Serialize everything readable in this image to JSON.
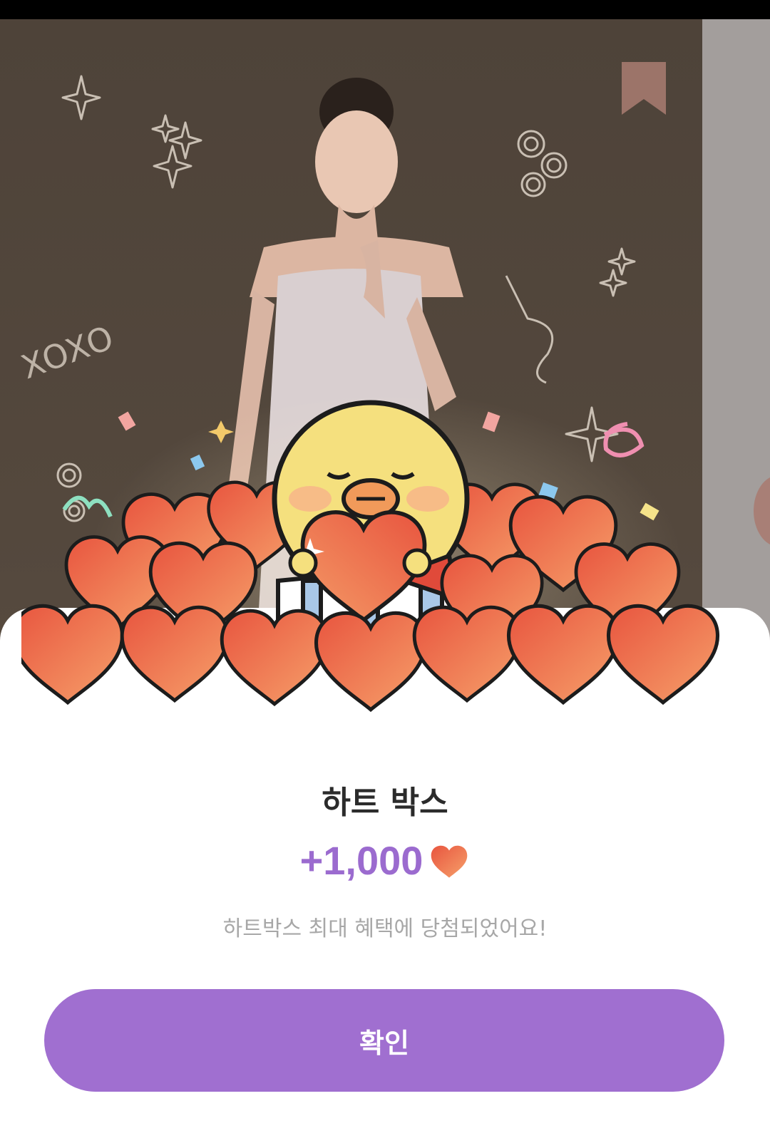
{
  "popup": {
    "title": "하트 박스",
    "reward_amount": "+1,000",
    "reward_icon": "heart-icon",
    "message": "하트박스 최대 혜택에 당첨되었어요!",
    "confirm_label": "확인"
  },
  "background": {
    "doodle_text": "XOXO",
    "bookmark_icon": "bookmark-icon"
  },
  "colors": {
    "accent_purple": "#9b6bcf",
    "button_purple": "#a06fd0",
    "heart_orange": "#f0744f",
    "title_text": "#2b2b2b",
    "subtitle_text": "#a7a7a7"
  }
}
